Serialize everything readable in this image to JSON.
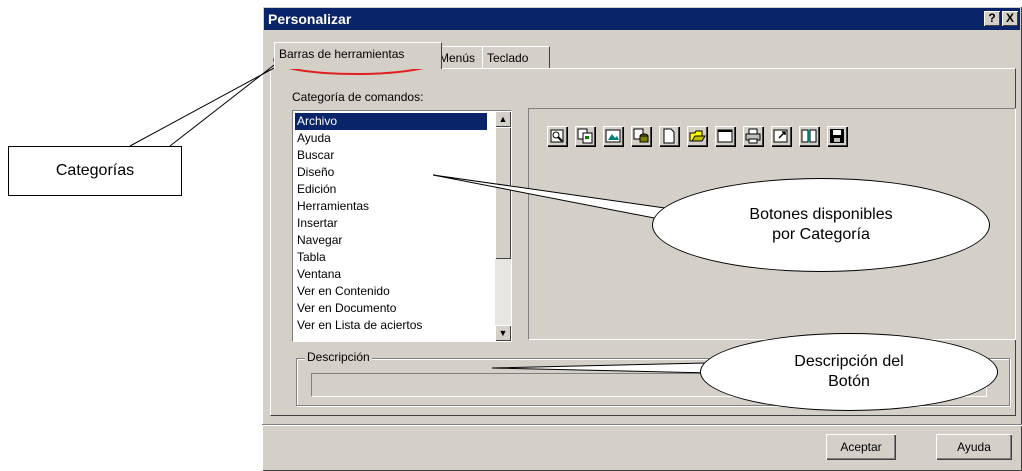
{
  "window": {
    "title": "Personalizar",
    "help_btn": "?",
    "close_btn": "X"
  },
  "tabs": [
    {
      "label": "Barras de herramientas",
      "active": true
    },
    {
      "label": "Menús",
      "active": false
    },
    {
      "label": "Teclado",
      "active": false
    }
  ],
  "category": {
    "label": "Categoría de comandos:",
    "items": [
      "Archivo",
      "Ayuda",
      "Buscar",
      "Diseño",
      "Edición",
      "Herramientas",
      "Insertar",
      "Navegar",
      "Tabla",
      "Ventana",
      "Ver en Contenido",
      "Ver en Documento",
      "Ver en Lista de aciertos"
    ],
    "selected": "Archivo"
  },
  "toolbar_buttons": [
    "preview-icon",
    "copy-icon",
    "image-icon",
    "database-icon",
    "new-document-icon",
    "open-folder-icon",
    "window-icon",
    "print-icon",
    "export-icon",
    "book-icon",
    "save-icon"
  ],
  "description": {
    "label": "Descripción",
    "value": ""
  },
  "buttons": {
    "ok": "Aceptar",
    "help": "Ayuda"
  },
  "callouts": {
    "categories": "Categorías",
    "tools": "Botones disponibles\npor Categoría",
    "desc": "Descripción del\nBotón"
  },
  "colors": {
    "titlebar": "#0a246a",
    "selection": "#0a246a",
    "dialog_bg": "#d4d0c8",
    "highlight_ring": "#e02020"
  }
}
